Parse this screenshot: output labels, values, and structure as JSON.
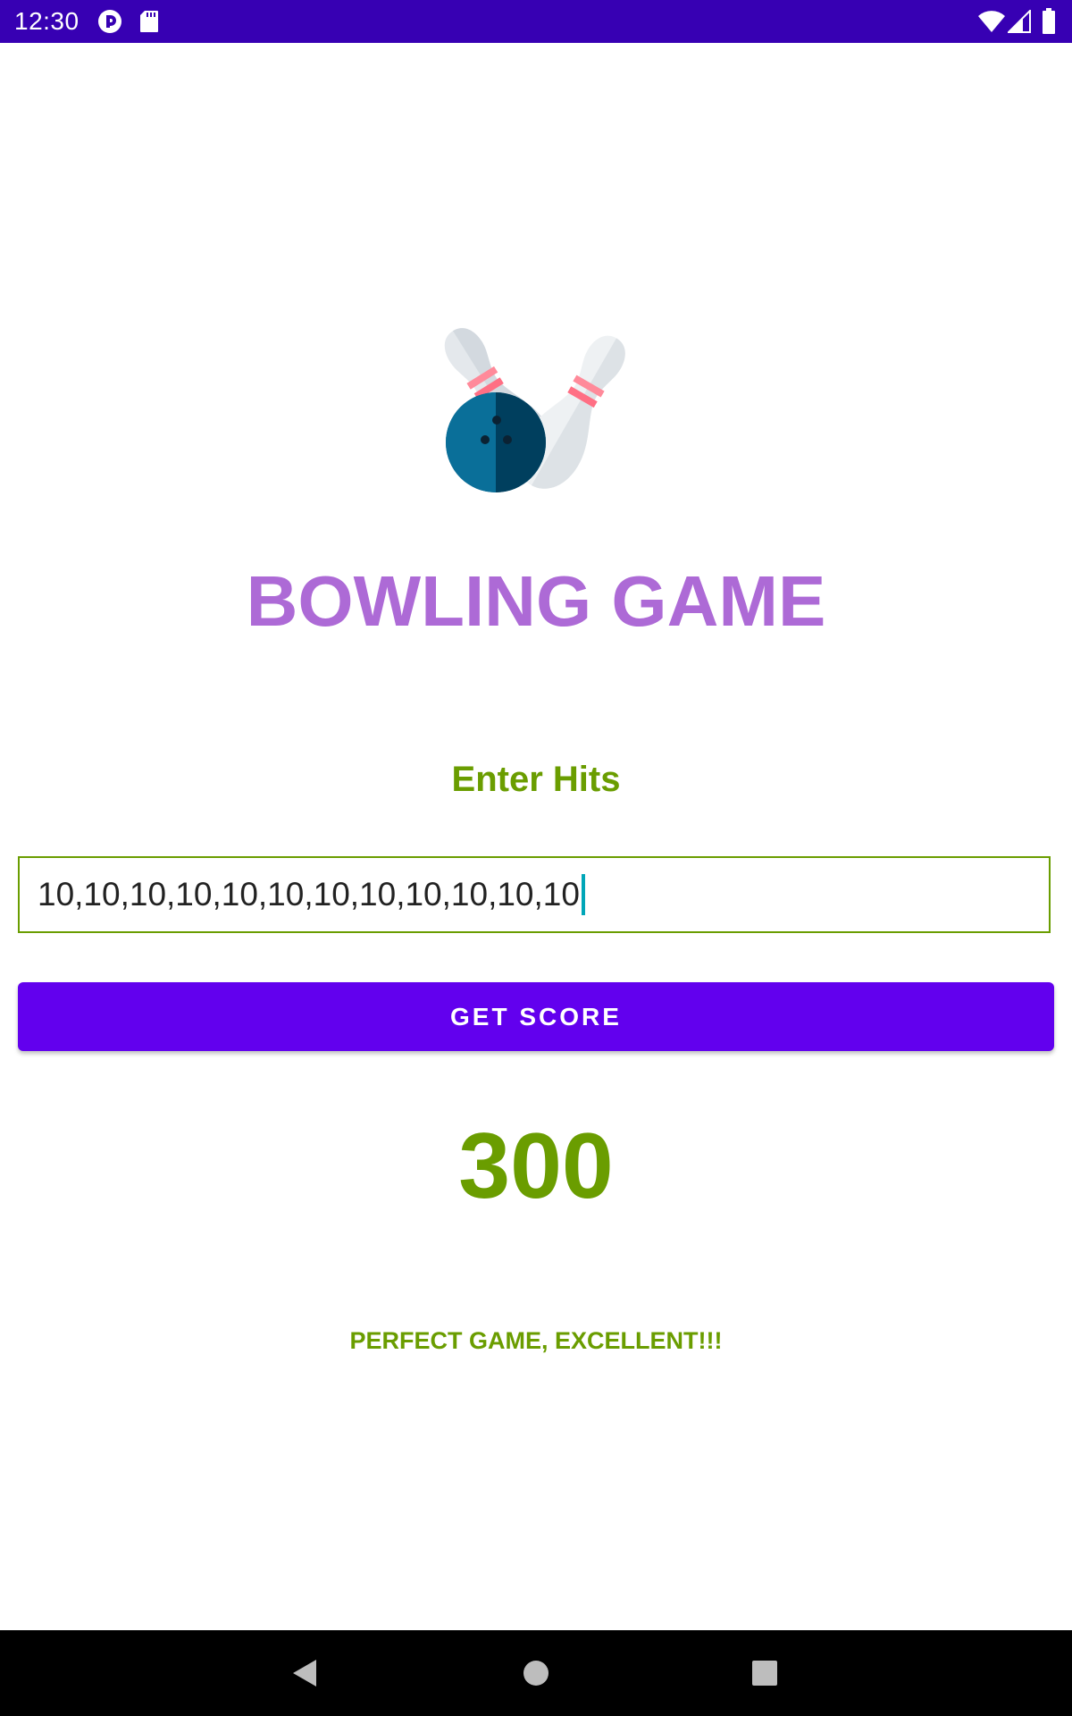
{
  "status_bar": {
    "time": "12:30",
    "left_icons": [
      "pocket-casts-icon",
      "sd-card-icon"
    ],
    "right_icons": [
      "wifi-icon",
      "signal-icon",
      "battery-icon"
    ],
    "background": "#3700b3"
  },
  "logo": {
    "icon": "bowling-pins-ball-icon"
  },
  "title": "BOWLING GAME",
  "input_label": "Enter Hits",
  "hits_input": {
    "value": "10,10,10,10,10,10,10,10,10,10,10,10"
  },
  "button": {
    "label": "GET SCORE"
  },
  "score": "300",
  "message": "PERFECT GAME, EXCELLENT!!!",
  "nav_bar": {
    "buttons": [
      "back-icon",
      "home-icon",
      "recents-icon"
    ]
  },
  "colors": {
    "title": "#ad6ad6",
    "accent_green": "#6a9d00",
    "button_bg": "#6200ee",
    "status_bar": "#3700b3",
    "caret": "#00a6b8"
  }
}
